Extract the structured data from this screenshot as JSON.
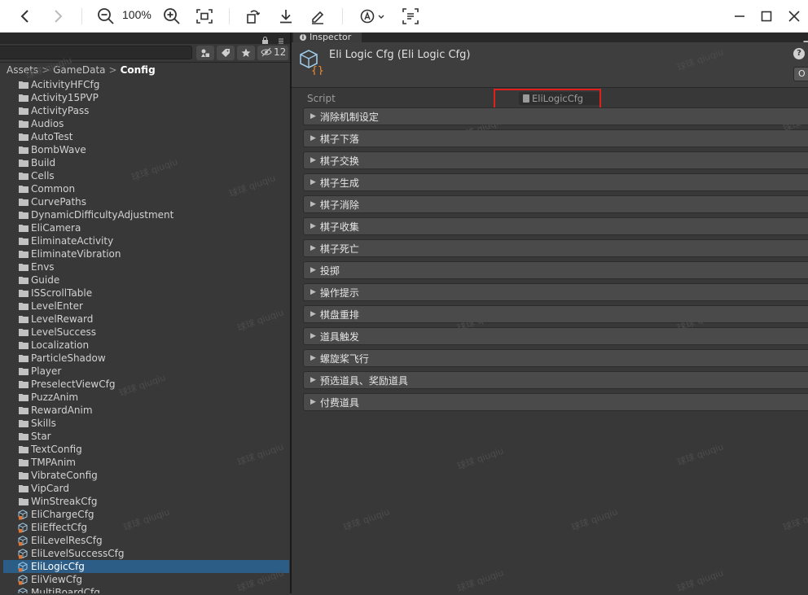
{
  "viewer": {
    "zoom": "100%",
    "icons": [
      "back-icon",
      "forward-icon",
      "zoom-out-icon",
      "zoom-in-icon",
      "fit-screen-icon",
      "rotate-icon",
      "download-icon",
      "annotate-icon",
      "translate-icon",
      "ocr-icon",
      "minimize-icon",
      "maximize-icon",
      "close-icon"
    ]
  },
  "project": {
    "hidden_count": "12",
    "breadcrumb": [
      "Assets",
      "GameData",
      "Config"
    ],
    "items": [
      {
        "label": "AcitivityHFCfg",
        "type": "folder"
      },
      {
        "label": "Activity15PVP",
        "type": "folder"
      },
      {
        "label": "ActivityPass",
        "type": "folder"
      },
      {
        "label": "Audios",
        "type": "folder"
      },
      {
        "label": "AutoTest",
        "type": "folder"
      },
      {
        "label": "BombWave",
        "type": "folder"
      },
      {
        "label": "Build",
        "type": "folder"
      },
      {
        "label": "Cells",
        "type": "folder"
      },
      {
        "label": "Common",
        "type": "folder"
      },
      {
        "label": "CurvePaths",
        "type": "folder"
      },
      {
        "label": "DynamicDifficultyAdjustment",
        "type": "folder"
      },
      {
        "label": "EliCamera",
        "type": "folder"
      },
      {
        "label": "EliminateActivity",
        "type": "folder"
      },
      {
        "label": "EliminateVibration",
        "type": "folder"
      },
      {
        "label": "Envs",
        "type": "folder"
      },
      {
        "label": "Guide",
        "type": "folder"
      },
      {
        "label": "ISScrollTable",
        "type": "folder"
      },
      {
        "label": "LevelEnter",
        "type": "folder"
      },
      {
        "label": "LevelReward",
        "type": "folder"
      },
      {
        "label": "LevelSuccess",
        "type": "folder"
      },
      {
        "label": "Localization",
        "type": "folder"
      },
      {
        "label": "ParticleShadow",
        "type": "folder"
      },
      {
        "label": "Player",
        "type": "folder"
      },
      {
        "label": "PreselectViewCfg",
        "type": "folder"
      },
      {
        "label": "PuzzAnim",
        "type": "folder"
      },
      {
        "label": "RewardAnim",
        "type": "folder"
      },
      {
        "label": "Skills",
        "type": "folder"
      },
      {
        "label": "Star",
        "type": "folder"
      },
      {
        "label": "TextConfig",
        "type": "folder"
      },
      {
        "label": "TMPAnim",
        "type": "folder"
      },
      {
        "label": "VibrateConfig",
        "type": "folder"
      },
      {
        "label": "VipCard",
        "type": "folder"
      },
      {
        "label": "WinStreakCfg",
        "type": "folder"
      },
      {
        "label": "EliChargeCfg",
        "type": "asset"
      },
      {
        "label": "EliEffectCfg",
        "type": "asset"
      },
      {
        "label": "EliLevelResCfg",
        "type": "asset"
      },
      {
        "label": "EliLevelSuccessCfg",
        "type": "asset"
      },
      {
        "label": "EliLogicCfg",
        "type": "asset",
        "selected": true
      },
      {
        "label": "EliViewCfg",
        "type": "asset"
      },
      {
        "label": "MultiBoardCfg",
        "type": "asset"
      }
    ]
  },
  "inspector": {
    "tab_label": "Inspector",
    "title": "Eli Logic Cfg (Eli Logic Cfg)",
    "help": "?",
    "open_button": "O",
    "script_label": "Script",
    "script_value": "EliLogicCfg",
    "sections": [
      "消除机制设定",
      "棋子下落",
      "棋子交换",
      "棋子生成",
      "棋子消除",
      "棋子收集",
      "棋子死亡",
      "投掷",
      "操作提示",
      "棋盘重排",
      "道具触发",
      "螺旋桨飞行",
      "预选道具、奖励道具",
      "付费道具"
    ]
  },
  "watermark": "球球 qiuqiu",
  "colors": {
    "selection": "#2c5d87",
    "highlight": "#e0201c",
    "panel": "#383838"
  }
}
